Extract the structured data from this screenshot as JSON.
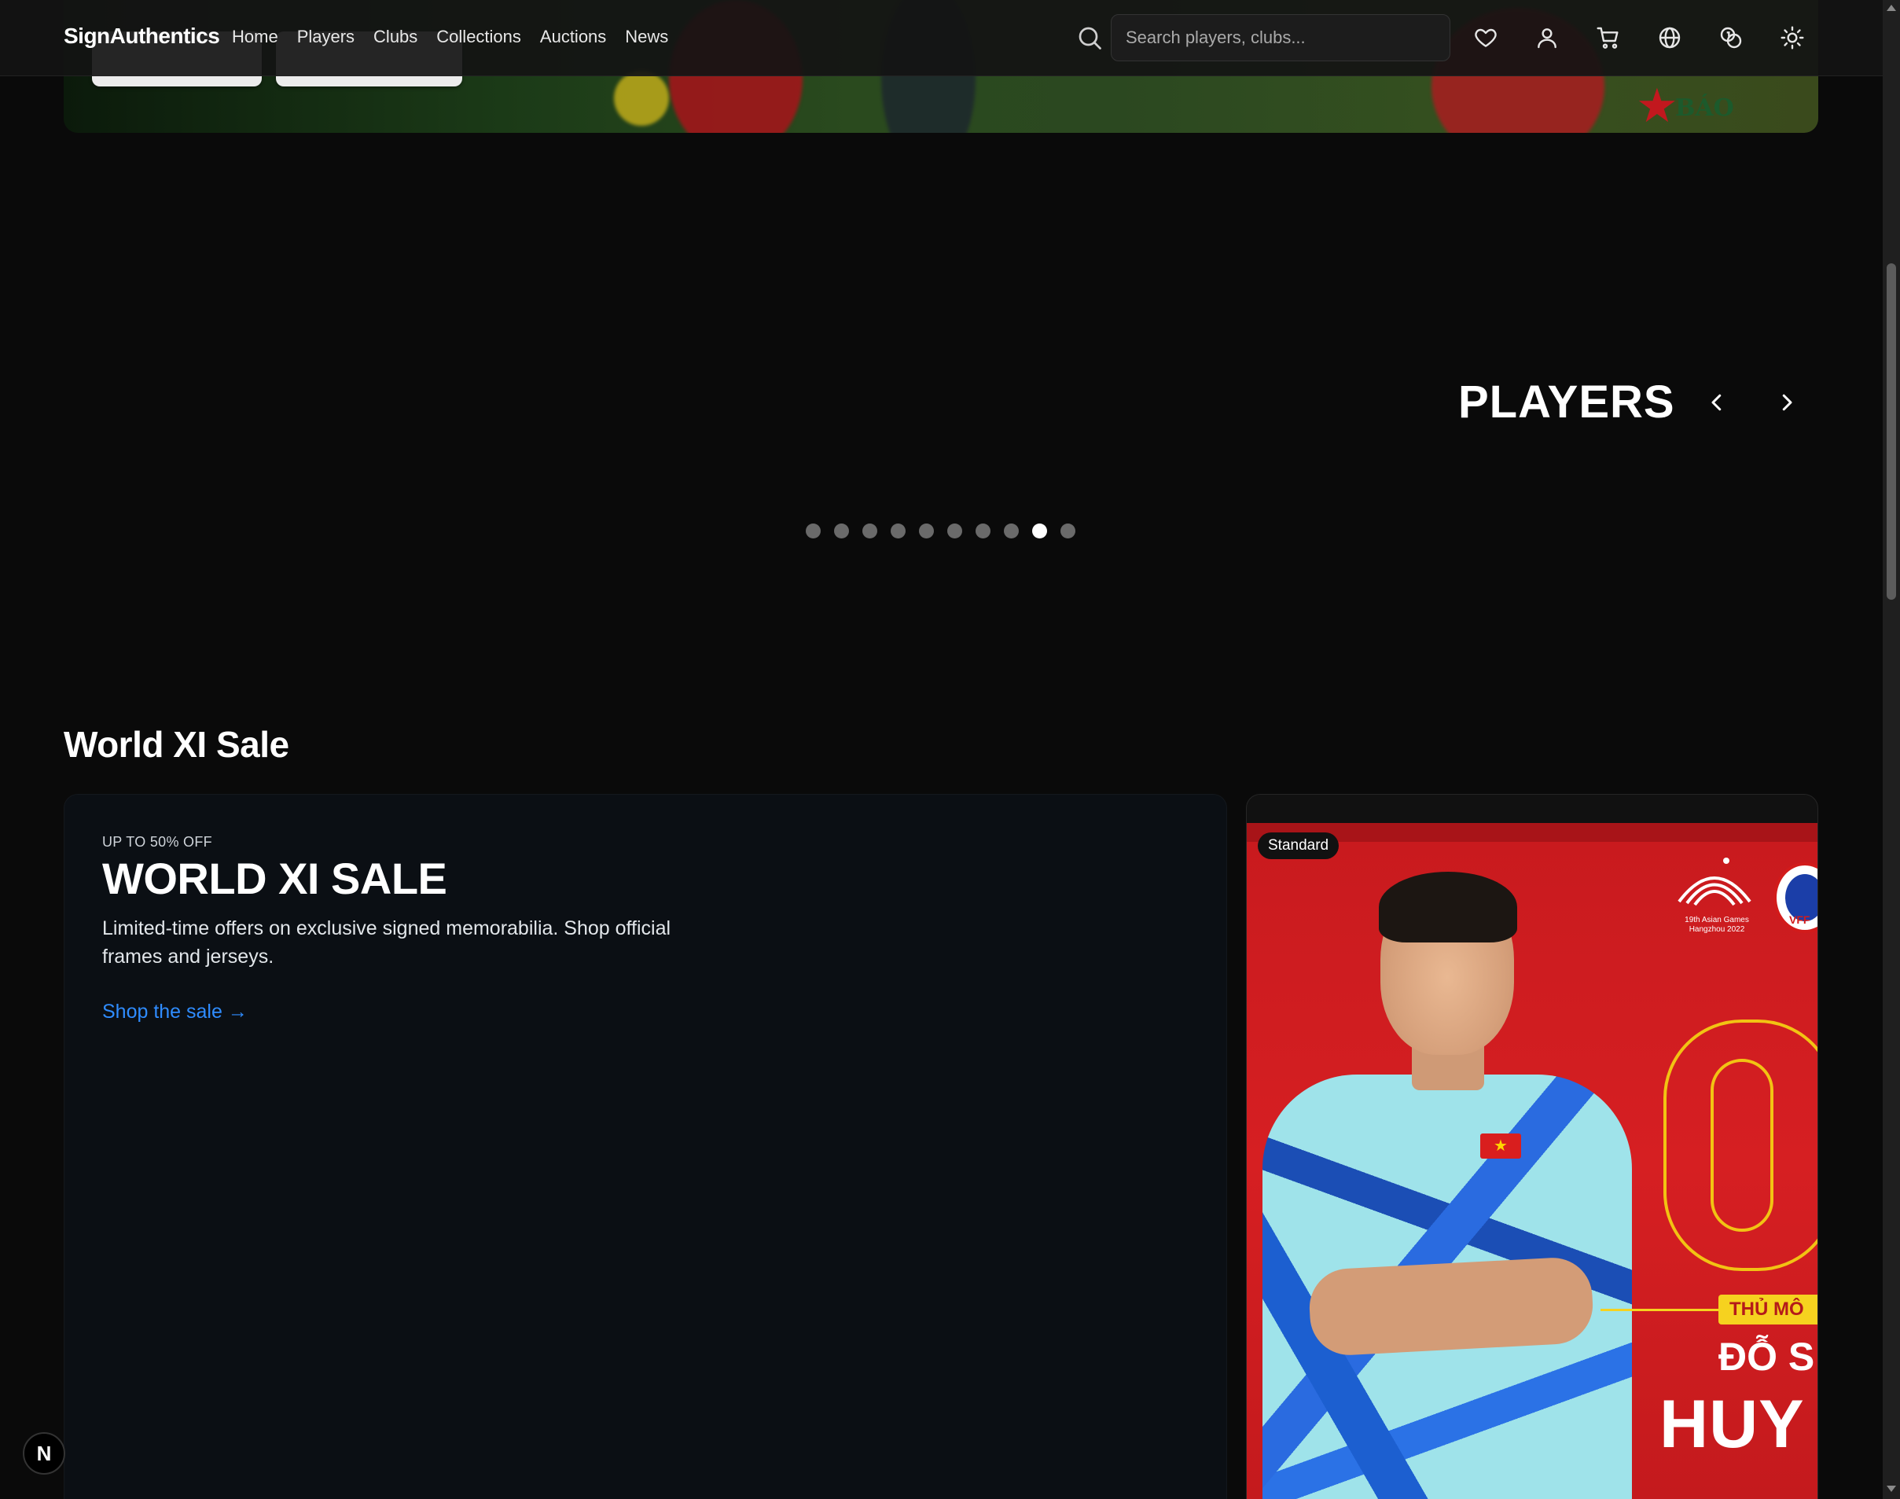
{
  "navbar": {
    "brand": "SignAuthentics",
    "links": [
      "Home",
      "Players",
      "Clubs",
      "Collections",
      "Auctions",
      "News"
    ],
    "search_placeholder": "Search players, clubs...",
    "icons": [
      "search-icon",
      "heart-icon",
      "user-icon",
      "cart-icon",
      "globe-icon",
      "coins-icon",
      "sun-icon"
    ]
  },
  "players": {
    "title": "PLAYERS",
    "carousel_dots": 10,
    "active_dot_index": 8
  },
  "world_xi": {
    "section_title": "World XI Sale",
    "eyebrow": "UP TO 50% OFF",
    "heading": "WORLD XI SALE",
    "description": "Limited-time offers on exclusive signed memorabilia. Shop official frames and jerseys.",
    "link": "Shop the sale →"
  },
  "product": {
    "badge": "Standard",
    "image_text": {
      "event": "19th Asian Games Hangzhou 2022",
      "federation": "VFF",
      "role": "THỦ MÔ",
      "name_line1": "ĐỖ S",
      "name_line2": "HUY"
    }
  },
  "hero": {
    "watermark": "BÁO"
  },
  "floating": {
    "label": "N"
  },
  "colors": {
    "background": "#0a0a0a",
    "accent_link": "#2f8cff",
    "card_bg": "#0b0f14",
    "product_red": "#d61f22"
  }
}
